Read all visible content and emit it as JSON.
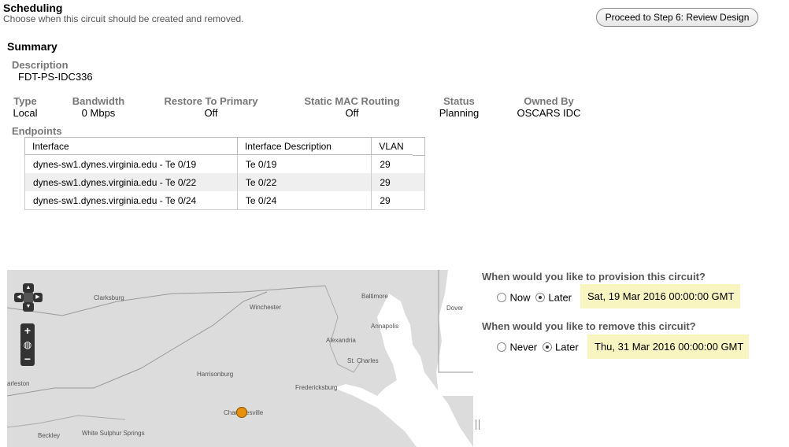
{
  "page": {
    "title": "Scheduling",
    "subtitle": "Choose when this circuit should be created and removed.",
    "proceed_button": "Proceed to Step 6: Review Design"
  },
  "summary": {
    "heading": "Summary",
    "description_label": "Description",
    "description_value": "FDT-PS-IDC336",
    "fields": {
      "type": {
        "label": "Type",
        "value": "Local"
      },
      "bandwidth": {
        "label": "Bandwidth",
        "value": "0 Mbps"
      },
      "restore": {
        "label": "Restore To Primary",
        "value": "Off"
      },
      "mac": {
        "label": "Static MAC Routing",
        "value": "Off"
      },
      "status": {
        "label": "Status",
        "value": "Planning"
      },
      "owner": {
        "label": "Owned By",
        "value": "OSCARS IDC"
      }
    },
    "endpoints_label": "Endpoints",
    "endpoints": {
      "columns": [
        "Interface",
        "Interface Description",
        "VLAN"
      ],
      "rows": [
        [
          "dynes-sw1.dynes.virginia.edu - Te 0/19",
          "Te 0/19",
          "29"
        ],
        [
          "dynes-sw1.dynes.virginia.edu - Te 0/22",
          "Te 0/22",
          "29"
        ],
        [
          "dynes-sw1.dynes.virginia.edu - Te 0/24",
          "Te 0/24",
          "29"
        ]
      ]
    }
  },
  "map": {
    "labels": [
      "Clarksburg",
      "Winchester",
      "Baltimore",
      "Annapolis",
      "Dover",
      "Alexandria",
      "St. Charles",
      "Harrisonburg",
      "Fredericksburg",
      "arleston",
      "Charlottesville",
      "Beckley",
      "White Sulphur Springs"
    ],
    "marker_color": "#e8900a",
    "land_color": "#dcdcdc",
    "water_color": "#ffffff"
  },
  "provision": {
    "question": "When would you like to provision this circuit?",
    "option_now": "Now",
    "option_later": "Later",
    "selected": "Later",
    "datetime": "Sat, 19 Mar 2016 00:00:00 GMT"
  },
  "remove": {
    "question": "When would you like to remove this circuit?",
    "option_never": "Never",
    "option_later": "Later",
    "selected": "Later",
    "datetime": "Thu, 31 Mar 2016 00:00:00 GMT"
  }
}
